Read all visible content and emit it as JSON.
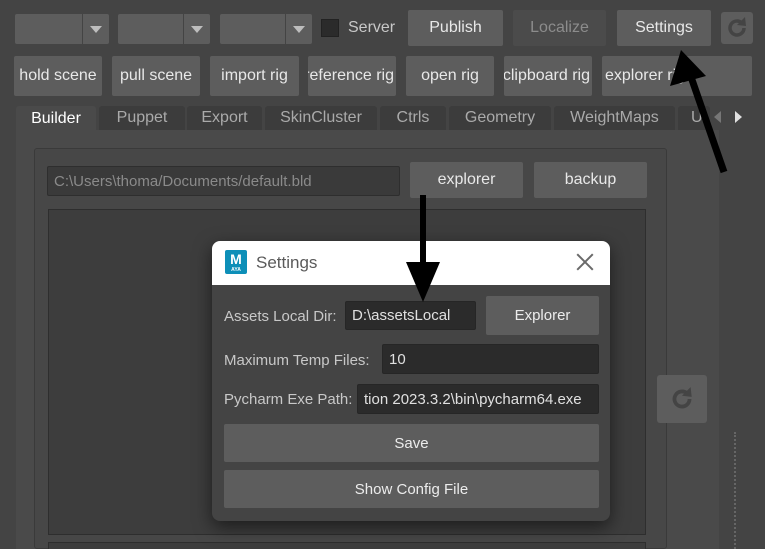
{
  "toolbar": {
    "dropdowns": [
      "",
      "",
      ""
    ],
    "server_label": "Server",
    "publish": "Publish",
    "localize": "Localize",
    "settings": "Settings"
  },
  "actions": [
    "hold scene",
    "pull scene",
    "import rig",
    "reference rig",
    "open rig",
    "clipboard rig",
    "explorer rig"
  ],
  "tabs": [
    "Builder",
    "Puppet",
    "Export",
    "SkinCluster",
    "Ctrls",
    "Geometry",
    "WeightMaps",
    "U"
  ],
  "builder": {
    "path": "C:\\Users\\thoma/Documents/default.bld",
    "explorer": "explorer",
    "backup": "backup"
  },
  "dialog": {
    "title": "Settings",
    "logo_letter": "M",
    "logo_sub": "AYA",
    "assets_label": "Assets Local Dir:",
    "assets_value": "D:\\assetsLocal",
    "explorer_btn": "Explorer",
    "max_temp_label": "Maximum Temp Files:",
    "max_temp_value": "10",
    "pycharm_label": "Pycharm Exe Path:",
    "pycharm_value": "tion 2023.3.2\\bin\\pycharm64.exe",
    "save": "Save",
    "show_config": "Show Config File"
  },
  "colors": {
    "logo": "#0d8fb8",
    "background": "#444444"
  },
  "icons": [
    "refresh-icon",
    "chevron-down-icon",
    "close-icon",
    "arrow-left-icon",
    "arrow-right-icon"
  ]
}
